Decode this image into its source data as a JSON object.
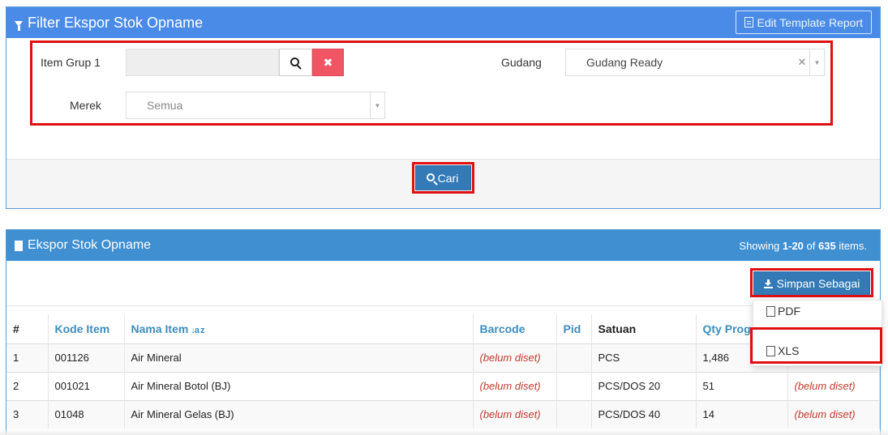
{
  "filter": {
    "title": "Filter Ekspor Stok Opname",
    "edit_template_label": "Edit Template Report",
    "item_group_label": "Item Grup 1",
    "item_group_value": "",
    "clear_glyph": "✖",
    "gudang_label": "Gudang",
    "gudang_value": "Gudang Ready",
    "merek_label": "Merek",
    "merek_value": "Semua",
    "cari_label": "Cari"
  },
  "export": {
    "title": "Ekspor Stok Opname",
    "showing_prefix": "Showing ",
    "showing_range": "1-20",
    "showing_of": " of ",
    "showing_total": "635",
    "showing_suffix": " items.",
    "save_as_label": "Simpan Sebagai",
    "menu": {
      "pdf_label": "PDF",
      "xls_label": "XLS"
    },
    "columns": [
      "#",
      "Kode Item",
      "Nama Item",
      "Barcode",
      "Pid",
      "Satuan",
      "Qty Prog"
    ],
    "sort_glyph": "↓a z",
    "rows": [
      {
        "no": "1",
        "kode": "001126",
        "nama": "Air Mineral",
        "barcode": "(belum diset)",
        "pid": "",
        "satuan": "PCS",
        "qty": "1,486",
        "extra": ""
      },
      {
        "no": "2",
        "kode": "001021",
        "nama": "Air Mineral Botol (BJ)",
        "barcode": "(belum diset)",
        "pid": "",
        "satuan": "PCS/DOS 20",
        "qty": "51",
        "extra": "(belum diset)"
      },
      {
        "no": "3",
        "kode": "01048",
        "nama": "Air Mineral Gelas (BJ)",
        "barcode": "(belum diset)",
        "pid": "",
        "satuan": "PCS/DOS 40",
        "qty": "14",
        "extra": "(belum diset)"
      }
    ]
  },
  "colors": {
    "panel_header": "#4a90e2",
    "primary_button": "#337ab7",
    "danger_button": "#ef5563",
    "highlight": "#e01010",
    "unset_text": "#c0392b"
  }
}
